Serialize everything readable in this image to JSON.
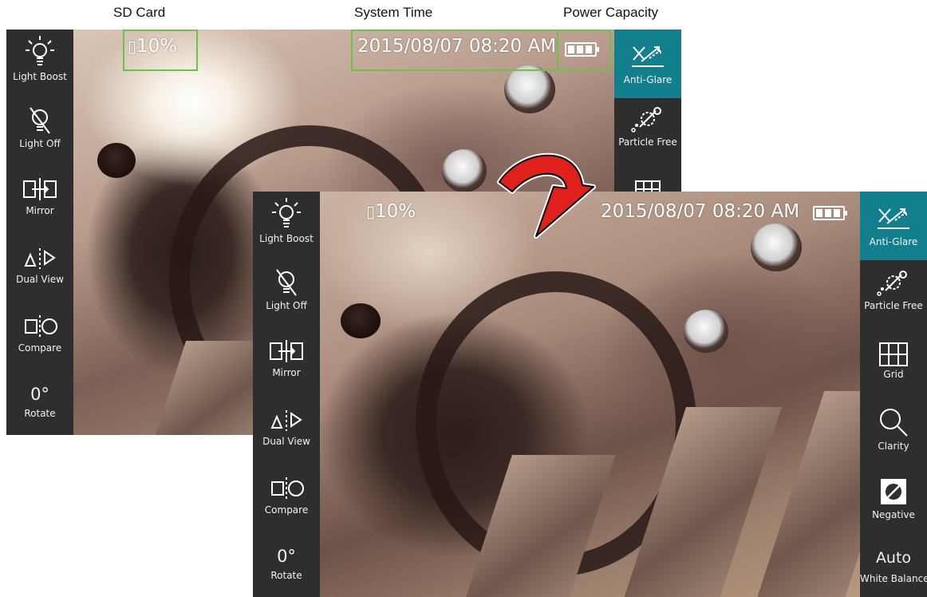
{
  "callouts": {
    "sd_card": "SD Card",
    "system_time": "System Time",
    "power_capacity": "Power Capacity"
  },
  "screens": [
    {
      "id": "before",
      "status": {
        "sd": "10%",
        "time": "2015/08/07 08:20 AM",
        "battery_level": 1.0
      },
      "left_tools": [
        {
          "label": "Light Boost",
          "icon": "bulb-rays-icon"
        },
        {
          "label": "Light Off",
          "icon": "bulb-off-icon"
        },
        {
          "label": "Mirror",
          "icon": "mirror-icon"
        },
        {
          "label": "Dual View",
          "icon": "dual-view-icon"
        },
        {
          "label": "Compare",
          "icon": "compare-icon"
        },
        {
          "label": "Rotate",
          "value": "0°",
          "icon": "rotate-icon"
        }
      ],
      "right_tools": [
        {
          "label": "Anti-Glare",
          "icon": "anti-glare-icon",
          "active": true
        },
        {
          "label": "Particle Free",
          "icon": "particle-free-icon"
        }
      ]
    },
    {
      "id": "after",
      "status": {
        "sd": "10%",
        "time": "2015/08/07 08:20 AM",
        "battery_level": 1.0
      },
      "left_tools": [
        {
          "label": "Light Boost",
          "icon": "bulb-rays-icon"
        },
        {
          "label": "Light Off",
          "icon": "bulb-off-icon"
        },
        {
          "label": "Mirror",
          "icon": "mirror-icon"
        },
        {
          "label": "Dual View",
          "icon": "dual-view-icon"
        },
        {
          "label": "Compare",
          "icon": "compare-icon"
        },
        {
          "label": "Rotate",
          "value": "0°",
          "icon": "rotate-icon"
        }
      ],
      "right_tools": [
        {
          "label": "Anti-Glare",
          "icon": "anti-glare-icon",
          "active": true
        },
        {
          "label": "Particle Free",
          "icon": "particle-free-icon"
        },
        {
          "label": "Grid",
          "icon": "grid-icon"
        },
        {
          "label": "Clarity",
          "icon": "magnifier-icon"
        },
        {
          "label": "Negative",
          "icon": "negative-icon"
        },
        {
          "label": "White Balance",
          "value": "Auto",
          "icon": "white-balance-icon"
        }
      ]
    }
  ],
  "colors": {
    "active_tool": "#127f8c",
    "highlight": "#6cc24a",
    "toolbar": "#2e2e2e",
    "arrow": "#e0201a"
  }
}
